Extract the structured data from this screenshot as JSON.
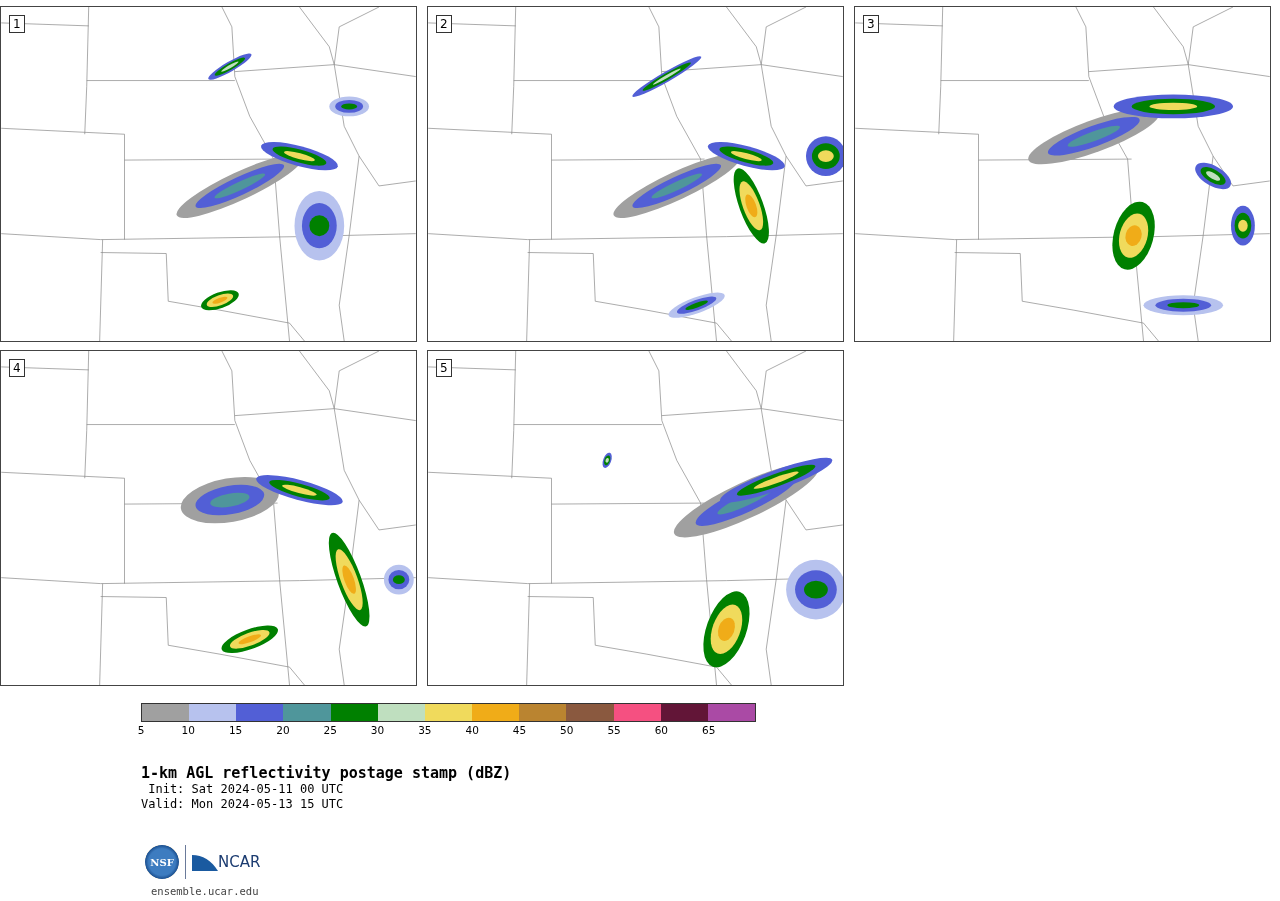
{
  "panels": [
    {
      "label": "1"
    },
    {
      "label": "2"
    },
    {
      "label": "3"
    },
    {
      "label": "4"
    },
    {
      "label": "5"
    }
  ],
  "colorbar": {
    "segments": [
      {
        "color": "#a0a0a0"
      },
      {
        "color": "#b7c2ee"
      },
      {
        "color": "#525fd6"
      },
      {
        "color": "#4f969b"
      },
      {
        "color": "#008000"
      },
      {
        "color": "#bfdfbf"
      },
      {
        "color": "#f0da5c"
      },
      {
        "color": "#f0ac18"
      },
      {
        "color": "#ba8430"
      },
      {
        "color": "#8a593f"
      },
      {
        "color": "#f55081"
      },
      {
        "color": "#621537"
      },
      {
        "color": "#aa4aa5"
      }
    ],
    "ticks": [
      "5",
      "10",
      "15",
      "20",
      "25",
      "30",
      "35",
      "40",
      "45",
      "50",
      "55",
      "60",
      "65"
    ]
  },
  "title": "1-km AGL reflectivity postage stamp (dBZ)",
  "init": " Init: Sat 2024-05-11 00 UTC",
  "valid": "Valid: Mon 2024-05-13 15 UTC",
  "logos": {
    "nsf": "NSF",
    "ncar": "NCAR"
  },
  "url": "ensemble.ucar.edu"
}
